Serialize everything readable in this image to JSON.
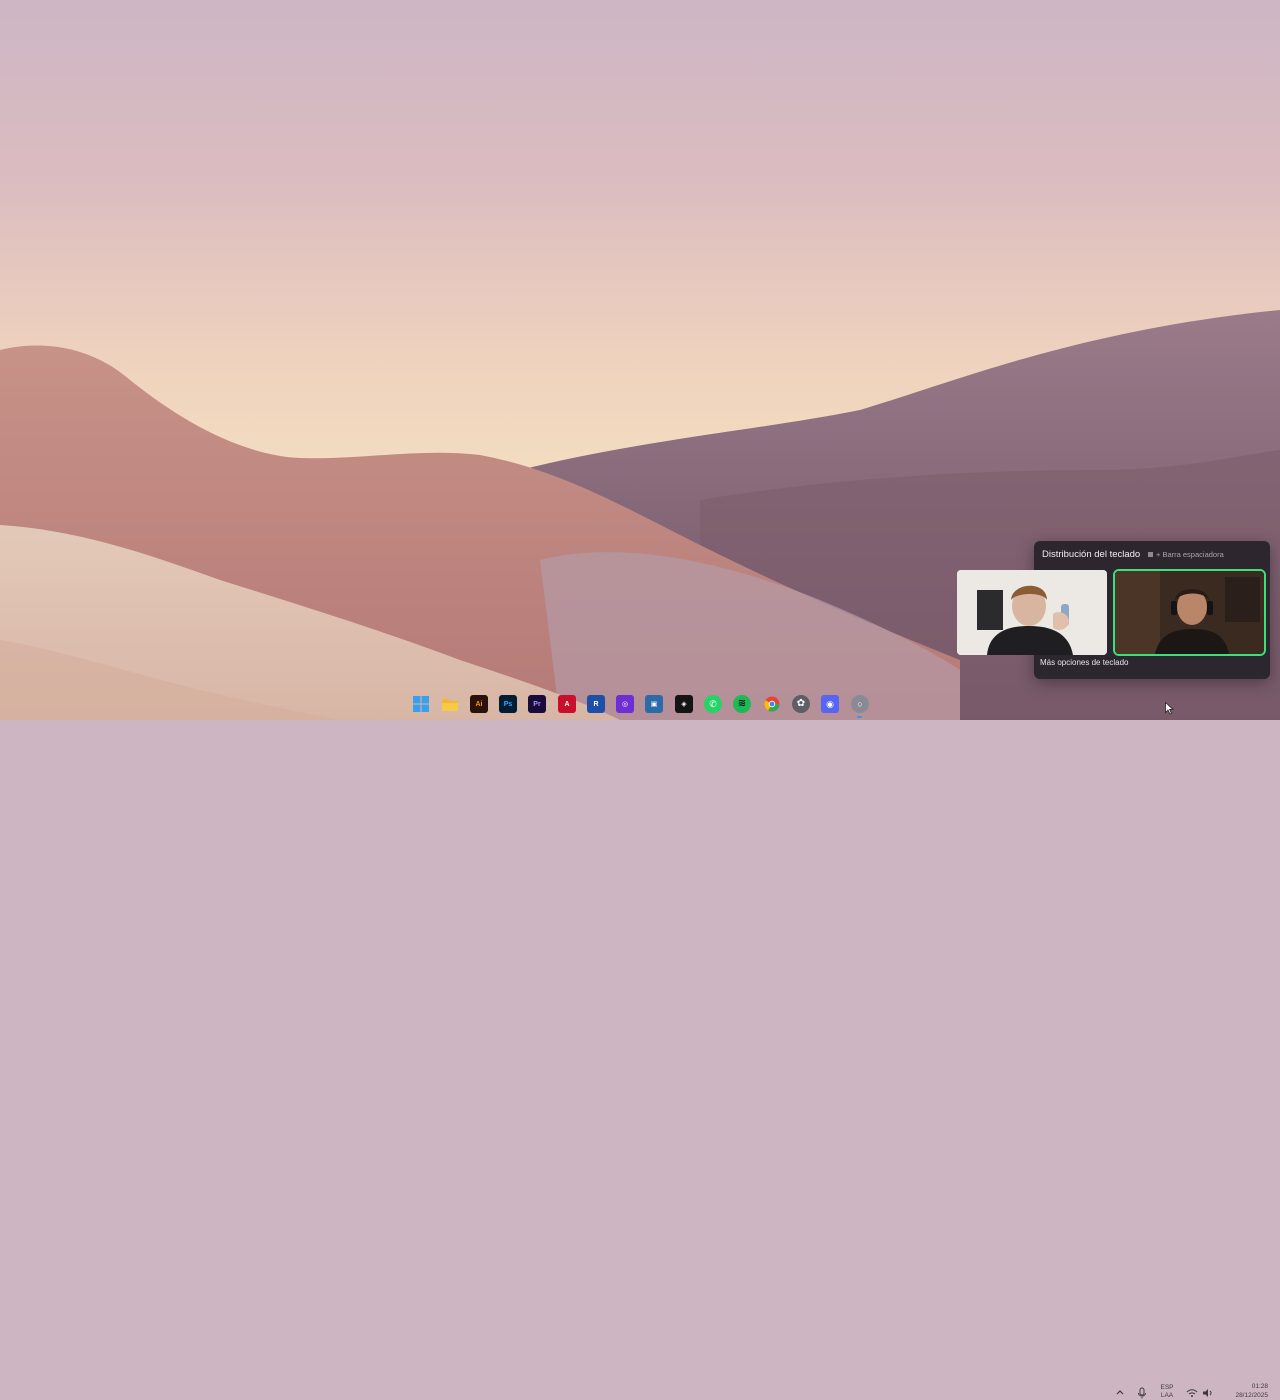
{
  "keyboard_flyout": {
    "title": "Distribución del teclado",
    "shortcut_hint": "+ Barra espaciadora",
    "more_options": "Más opciones de teclado"
  },
  "taskbar": {
    "pinned": [
      {
        "name": "start-icon",
        "label": "",
        "color": "#1f8fe0"
      },
      {
        "name": "file-explorer-icon",
        "label": "",
        "color": "#f2b630"
      },
      {
        "name": "illustrator-icon",
        "label": "Ai",
        "color": "#2b1206"
      },
      {
        "name": "photoshop-icon",
        "label": "Ps",
        "color": "#001d34"
      },
      {
        "name": "premiere-icon",
        "label": "Pr",
        "color": "#1a0b3a"
      },
      {
        "name": "acrobat-icon",
        "label": "A",
        "color": "#c8102e"
      },
      {
        "name": "r-app-icon",
        "label": "R",
        "color": "#1d4fa6"
      },
      {
        "name": "app-purple-icon",
        "label": "◎",
        "color": "#6d2fd4"
      },
      {
        "name": "app-blue-icon",
        "label": "▣",
        "color": "#2c6aa8"
      },
      {
        "name": "app-dark-icon",
        "label": "◈",
        "color": "#141414"
      },
      {
        "name": "whatsapp-icon",
        "label": "✆",
        "color": "#25d366"
      },
      {
        "name": "spotify-icon",
        "label": "≋",
        "color": "#1db954"
      },
      {
        "name": "chrome-icon",
        "label": "",
        "color": "#ea4335"
      },
      {
        "name": "chatgpt-icon",
        "label": "✿",
        "color": "#5e5e66"
      },
      {
        "name": "discord-icon",
        "label": "◉",
        "color": "#5865f2"
      },
      {
        "name": "app-light-icon",
        "label": "○",
        "color": "#8a8a94"
      }
    ],
    "tray": {
      "lang_line1": "ESP",
      "lang_line2": "LAA",
      "time": "01:28",
      "date": "28/12/2025"
    }
  }
}
